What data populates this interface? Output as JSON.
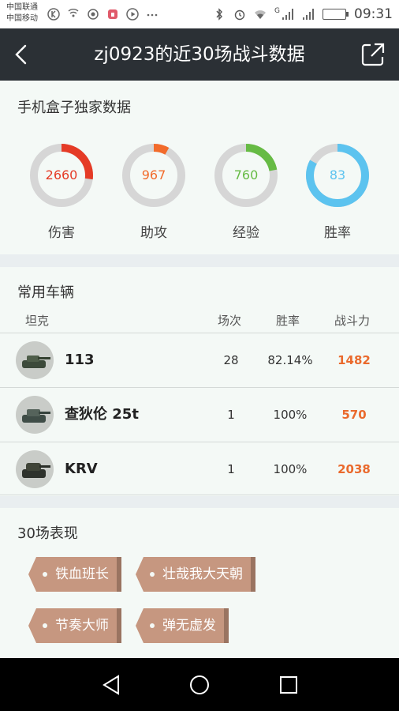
{
  "status_bar": {
    "carrier_1": "中国联通",
    "carrier_2": "中国移动",
    "time": "09:31",
    "signal_tag": "G",
    "icons": [
      "k-icon",
      "wifi-hotspot-icon",
      "camera-icon",
      "lock-app-icon",
      "play-icon",
      "more-dots-icon",
      "bluetooth-icon",
      "alarm-icon",
      "wifi-icon",
      "signal-icon",
      "battery-icon"
    ]
  },
  "header": {
    "title": "zj0923的近30场战斗数据"
  },
  "stats": {
    "title": "手机盒子独家数据",
    "items": [
      {
        "label": "伤害",
        "value": "2660",
        "ratio": 0.27,
        "color": "#e53b26"
      },
      {
        "label": "助攻",
        "value": "967",
        "ratio": 0.08,
        "color": "#f26b2b"
      },
      {
        "label": "经验",
        "value": "760",
        "ratio": 0.22,
        "color": "#66bb44"
      },
      {
        "label": "胜率",
        "value": "83",
        "ratio": 0.83,
        "color": "#5cc3ef"
      }
    ]
  },
  "vehicles": {
    "title": "常用车辆",
    "columns": {
      "tank": "坦克",
      "battles": "场次",
      "winrate": "胜率",
      "power": "战斗力"
    },
    "rows": [
      {
        "name": "113",
        "battles": "28",
        "winrate": "82.14%",
        "power": "1482"
      },
      {
        "name": "查狄伦 25t",
        "battles": "1",
        "winrate": "100%",
        "power": "570"
      },
      {
        "name": "KRV",
        "battles": "1",
        "winrate": "100%",
        "power": "2038"
      }
    ]
  },
  "performance": {
    "title": "30场表现",
    "tags": [
      "铁血班长",
      "壮哉我大天朝",
      "节奏大师",
      "弹无虚发"
    ]
  },
  "colors": {
    "header_bg": "#2b3035",
    "accent_orange": "#ea6a2d",
    "tag_bg": "#c69780"
  }
}
